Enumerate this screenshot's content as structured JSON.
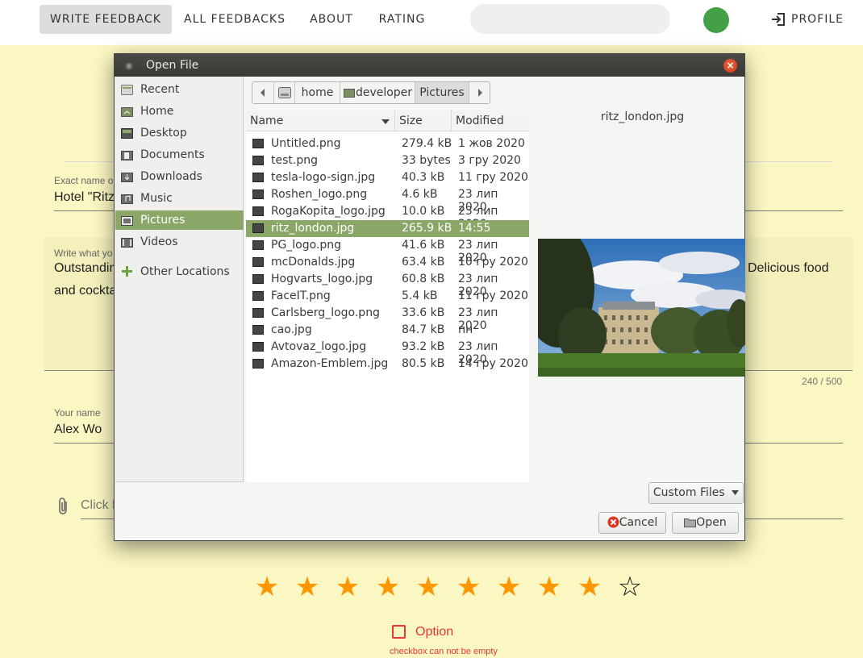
{
  "nav": {
    "items": [
      {
        "label": "WRITE FEEDBACK",
        "active": true
      },
      {
        "label": "ALL FEEDBACKS",
        "active": false
      },
      {
        "label": "ABOUT",
        "active": false
      },
      {
        "label": "RATING",
        "active": false
      }
    ],
    "search_placeholder": "",
    "profile_label": "PROFILE",
    "status_color": "#43a047"
  },
  "form": {
    "hotel_label": "Exact name o",
    "hotel_value": "Hotel \"Ritz",
    "feedback_label": "Write what yo",
    "feedback_line1_left": "Outstandin",
    "feedback_line1_right": "Delicious food",
    "feedback_line2_left": "and cockta",
    "counter": "240 / 500",
    "name_label": "Your name",
    "name_value": "Alex Wo",
    "attach_text": "Click l",
    "rating": {
      "filled": 9,
      "total": 10,
      "filled_color": "#ff9800"
    },
    "option_label": "Option",
    "option_error": "checkbox can not be empty"
  },
  "dialog": {
    "title": "Open File",
    "close_icon": "close-icon",
    "places": [
      {
        "label": "Recent",
        "icon": "recent-icon"
      },
      {
        "label": "Home",
        "icon": "home-folder-icon"
      },
      {
        "label": "Desktop",
        "icon": "desktop-icon"
      },
      {
        "label": "Documents",
        "icon": "documents-folder-icon"
      },
      {
        "label": "Downloads",
        "icon": "downloads-folder-icon"
      },
      {
        "label": "Music",
        "icon": "music-folder-icon"
      },
      {
        "label": "Pictures",
        "icon": "pictures-folder-icon",
        "active": true
      },
      {
        "label": "Videos",
        "icon": "videos-folder-icon"
      },
      {
        "label": "Other Locations",
        "icon": "plus-icon"
      }
    ],
    "path": [
      "home",
      "developer",
      "Pictures"
    ],
    "columns": {
      "name": "Name",
      "size": "Size",
      "modified": "Modified"
    },
    "files": [
      {
        "name": "Untitled.png",
        "size": "279.4 kB",
        "modified": "1 жов 2020"
      },
      {
        "name": "test.png",
        "size": "33 bytes",
        "modified": "3 гру 2020"
      },
      {
        "name": "tesla-logo-sign.jpg",
        "size": "40.3 kB",
        "modified": "11 гру 2020"
      },
      {
        "name": "Roshen_logo.png",
        "size": "4.6 kB",
        "modified": "23 лип 2020"
      },
      {
        "name": "RogaKopita_logo.jpg",
        "size": "10.0 kB",
        "modified": "23 лип 2020"
      },
      {
        "name": "ritz_london.jpg",
        "size": "265.9 kB",
        "modified": "14:55",
        "selected": true
      },
      {
        "name": "PG_logo.png",
        "size": "41.6 kB",
        "modified": "23 лип 2020"
      },
      {
        "name": "mcDonalds.jpg",
        "size": "63.4 kB",
        "modified": "10 гру 2020"
      },
      {
        "name": "Hogvarts_logo.jpg",
        "size": "60.8 kB",
        "modified": "23 лип 2020"
      },
      {
        "name": "FaceIT.png",
        "size": "5.4 kB",
        "modified": "11 гру 2020"
      },
      {
        "name": "Carlsberg_logo.png",
        "size": "33.6 kB",
        "modified": "23 лип 2020"
      },
      {
        "name": "cao.jpg",
        "size": "84.7 kB",
        "modified": "пн"
      },
      {
        "name": "Avtovaz_logo.jpg",
        "size": "93.2 kB",
        "modified": "23 лип 2020"
      },
      {
        "name": "Amazon-Emblem.jpg",
        "size": "80.5 kB",
        "modified": "14 гру 2020"
      }
    ],
    "preview_name": "ritz_london.jpg",
    "filter_label": "Custom Files",
    "cancel_label": "Cancel",
    "open_label": "Open",
    "selection_color": "#8aa768"
  }
}
